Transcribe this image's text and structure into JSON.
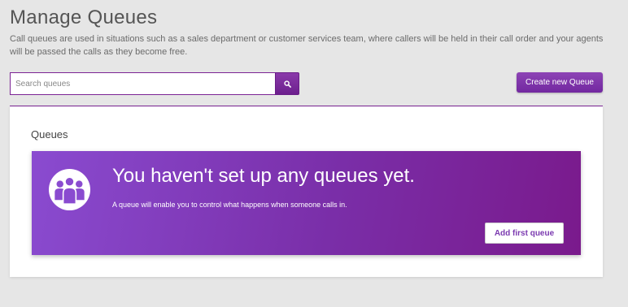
{
  "header": {
    "title": "Manage Queues",
    "description": "Call queues are used in situations such as a sales department or customer services team, where callers will be held in their call order and your agents will be passed the calls as they become free."
  },
  "search": {
    "placeholder": "Search queues",
    "value": "",
    "icon": "search-icon"
  },
  "toolbar": {
    "create_label": "Create new Queue"
  },
  "queues_panel": {
    "title": "Queues",
    "empty_state": {
      "icon": "group-users-icon",
      "heading": "You haven't set up any queues yet.",
      "text": "A queue will enable you to control what happens when someone calls in.",
      "button_label": "Add first queue"
    }
  },
  "colors": {
    "accent": "#7b2394",
    "button_gradient_top": "#8d44b5",
    "card_gradient_start": "#8a4bd0",
    "card_gradient_end": "#7a1a8c"
  }
}
